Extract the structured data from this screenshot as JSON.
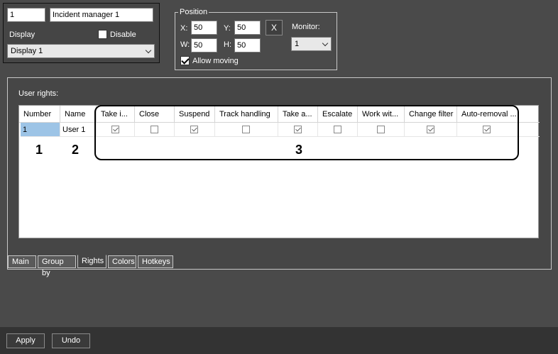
{
  "identity": {
    "id_value": "1",
    "name_value": "Incident manager 1",
    "display_label": "Display",
    "disable_label": "Disable",
    "disable_checked": false,
    "display_select": "Display 1"
  },
  "position": {
    "legend": "Position",
    "x_label": "X:",
    "x_value": "50",
    "y_label": "Y:",
    "y_value": "50",
    "w_label": "W:",
    "w_value": "50",
    "h_label": "H:",
    "h_value": "50",
    "reset_label": "X",
    "monitor_label": "Monitor:",
    "monitor_value": "1",
    "allow_moving_label": "Allow moving",
    "allow_moving_checked": true
  },
  "rights": {
    "section_label": "User rights:",
    "columns": [
      "Number",
      "Name",
      "Take i...",
      "Close",
      "Suspend",
      "Track handling",
      "Take a...",
      "Escalate",
      "Work wit...",
      "Change filter",
      "Auto-removal ..."
    ],
    "row": {
      "number": "1",
      "name": "User 1",
      "permissions": [
        true,
        false,
        true,
        false,
        true,
        false,
        false,
        true,
        true
      ]
    },
    "callouts": [
      "1",
      "2",
      "3"
    ]
  },
  "tabs": [
    "Main",
    "Group by",
    "Rights",
    "Colors",
    "Hotkeys"
  ],
  "active_tab": "Rights",
  "footer": {
    "apply_label": "Apply",
    "undo_label": "Undo"
  }
}
